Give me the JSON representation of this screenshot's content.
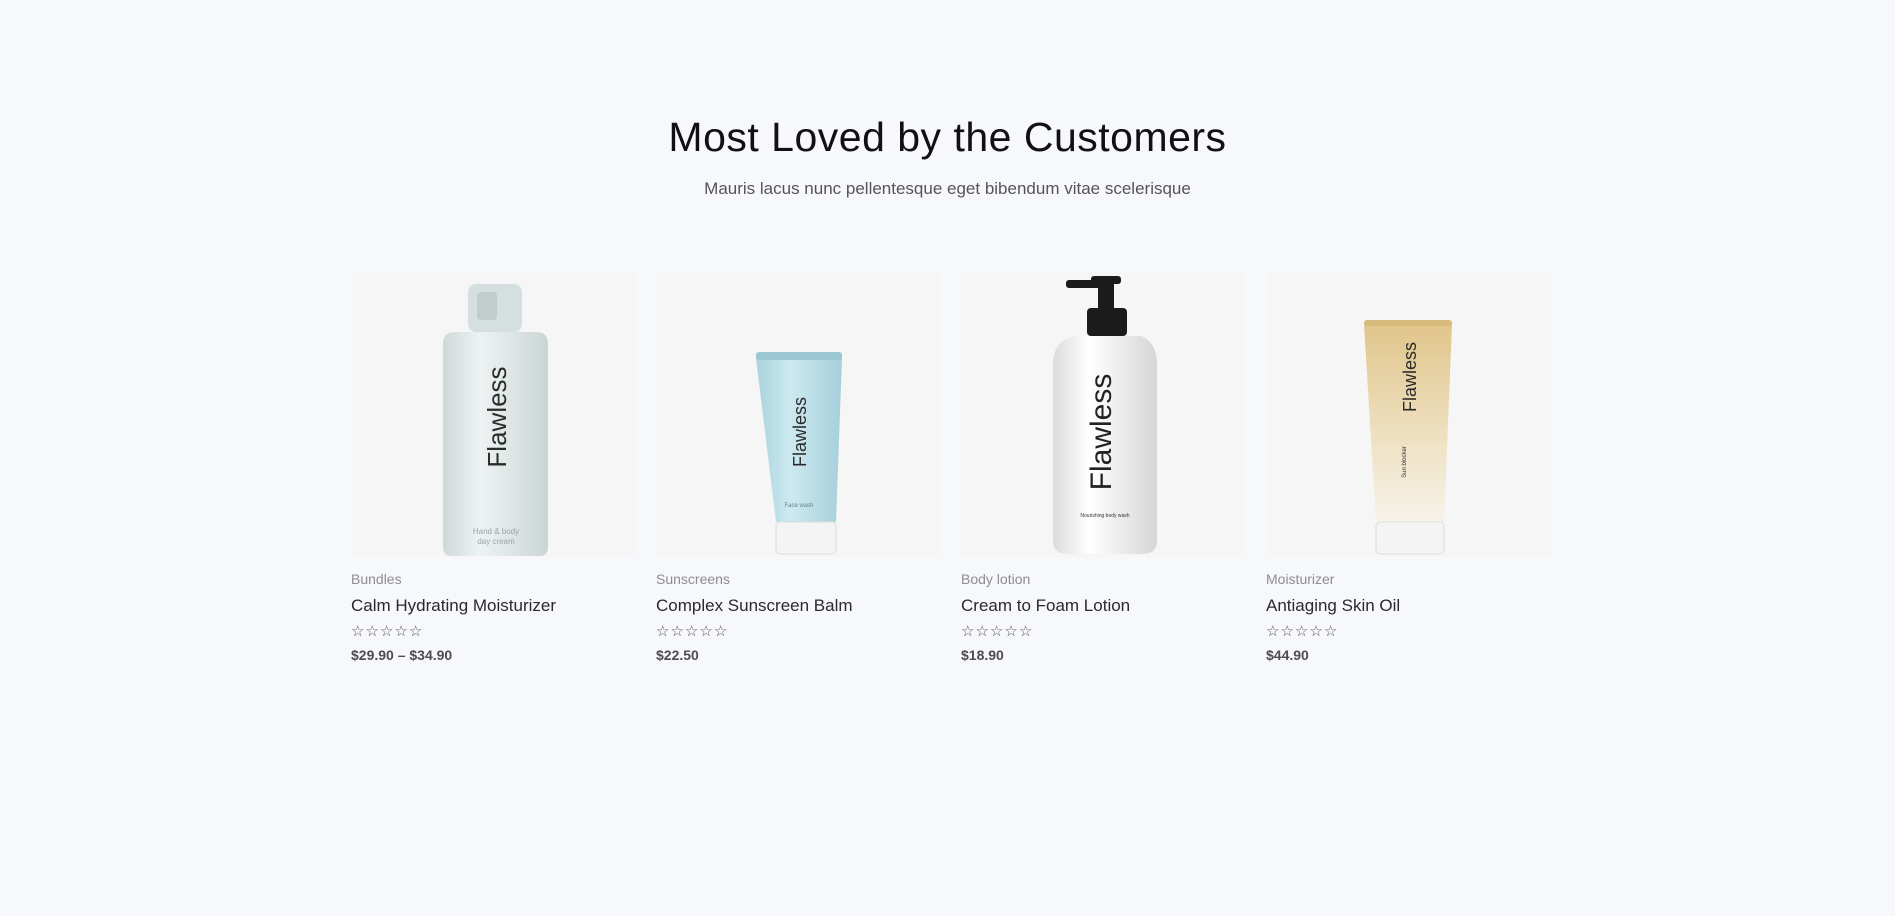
{
  "section": {
    "title": "Most Loved by the Customers",
    "subtitle": "Mauris lacus nunc pellentesque eget bibendum vitae scelerisque"
  },
  "products": [
    {
      "category": "Bundles",
      "name": "Calm Hydrating Moisturizer",
      "rating": 0,
      "price": "$29.90 – $34.90",
      "image": {
        "type": "bottle",
        "brand": "Flawless",
        "label": "Hand & body\nday cream",
        "color": "#dfe6e6"
      }
    },
    {
      "category": "Sunscreens",
      "name": "Complex Sunscreen Balm",
      "rating": 0,
      "price": "$22.50",
      "image": {
        "type": "tube",
        "brand": "Flawless",
        "label": "Face wash",
        "color": "#bfe1ea"
      }
    },
    {
      "category": "Body lotion",
      "name": "Cream to Foam Lotion",
      "rating": 0,
      "price": "$18.90",
      "image": {
        "type": "pump",
        "brand": "Flawless",
        "label": "Nourishing body wash",
        "color": "#f2f2f2"
      }
    },
    {
      "category": "Moisturizer",
      "name": "Antiaging Skin Oil",
      "rating": 0,
      "price": "$44.90",
      "image": {
        "type": "tube-gold",
        "brand": "Flawless",
        "label": "Sun blocker",
        "color": "#e6d3a8"
      }
    }
  ]
}
